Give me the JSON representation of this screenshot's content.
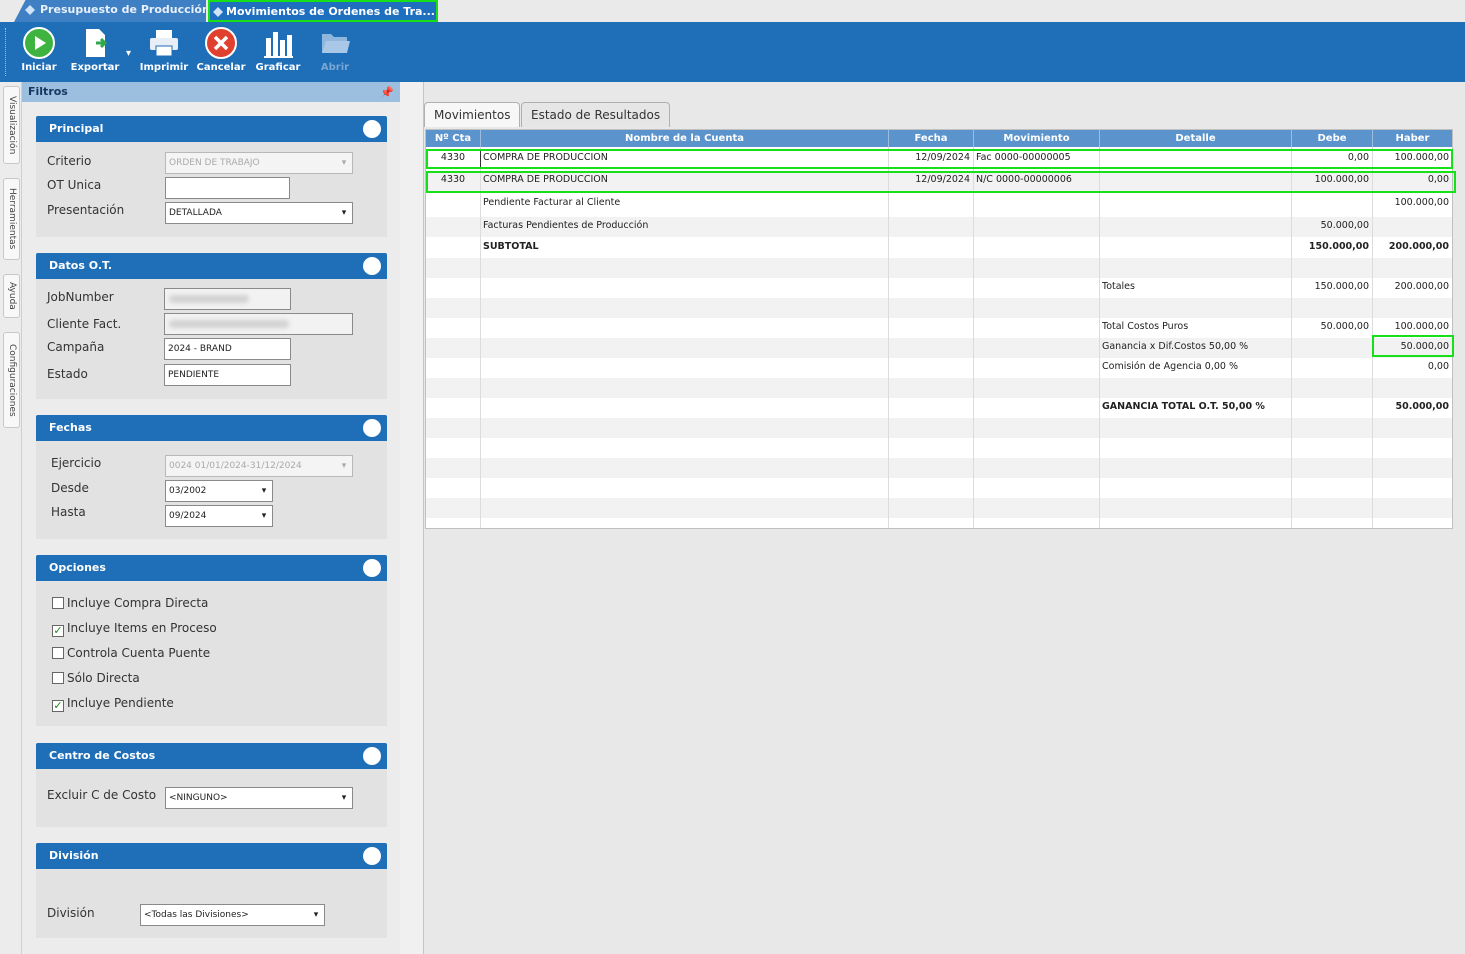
{
  "doc_tabs": [
    {
      "label": "Presupuesto de Producción"
    },
    {
      "label": "Movimientos de Ordenes de Tra..."
    }
  ],
  "toolbar": {
    "buttons": [
      {
        "label": "Iniciar",
        "icon": "play-icon"
      },
      {
        "label": "Exportar",
        "icon": "export-icon"
      },
      {
        "label": "Imprimir",
        "icon": "printer-icon"
      },
      {
        "label": "Cancelar",
        "icon": "cancel-icon"
      },
      {
        "label": "Graficar",
        "icon": "bar-chart-icon"
      },
      {
        "label": "Abrir",
        "icon": "folder-open-icon",
        "disabled": true
      }
    ]
  },
  "side_tabs": [
    "Visualización",
    "Herramientas",
    "Ayuda",
    "Configuraciones"
  ],
  "filters": {
    "title": "Filtros",
    "principal": {
      "title": "Principal",
      "criterio_label": "Criterio",
      "criterio_value": "ORDEN DE TRABAJO",
      "ot_unica_label": "OT Unica",
      "presentacion_label": "Presentación",
      "presentacion_value": "DETALLADA"
    },
    "datos_ot": {
      "title": "Datos O.T.",
      "jobnumber_label": "JobNumber",
      "cliente_label": "Cliente Fact.",
      "campana_label": "Campaña",
      "campana_value": "2024 - BRAND",
      "estado_label": "Estado",
      "estado_value": "PENDIENTE"
    },
    "fechas": {
      "title": "Fechas",
      "ejercicio_label": "Ejercicio",
      "ejercicio_value": "0024 01/01/2024-31/12/2024",
      "desde_label": "Desde",
      "desde_value": "03/2002",
      "hasta_label": "Hasta",
      "hasta_value": "09/2024"
    },
    "opciones": {
      "title": "Opciones",
      "items": [
        {
          "label": "Incluye Compra Directa",
          "checked": false
        },
        {
          "label": "Incluye Items en Proceso",
          "checked": true
        },
        {
          "label": "Controla Cuenta Puente",
          "checked": false
        },
        {
          "label": "Sólo Directa",
          "checked": false
        },
        {
          "label": "Incluye Pendiente",
          "checked": true
        }
      ]
    },
    "centro_costos": {
      "title": "Centro de Costos",
      "excluir_label": "Excluir C de Costo",
      "excluir_value": "<NINGUNO>"
    },
    "division": {
      "title": "División",
      "division_label": "División",
      "division_value": "<Todas las Divisiones>"
    }
  },
  "result_tabs": [
    "Movimientos",
    "Estado de Resultados"
  ],
  "grid": {
    "columns": [
      "Nº Cta",
      "Nombre de la Cuenta",
      "Fecha",
      "Movimiento",
      "Detalle",
      "Debe",
      "Haber"
    ],
    "rows": [
      {
        "cta": "4330",
        "nombre": "COMPRA DE PRODUCCION",
        "fecha": "12/09/2024",
        "mov": "Fac 0000-00000005",
        "detalle": "",
        "debe": "0,00",
        "haber": "100.000,00"
      },
      {
        "cta": "4330",
        "nombre": "COMPRA DE PRODUCCION",
        "fecha": "12/09/2024",
        "mov": "N/C 0000-00000006",
        "detalle": "",
        "debe": "100.000,00",
        "haber": "0,00"
      },
      {
        "cta": "",
        "nombre": "Pendiente Facturar al Cliente",
        "fecha": "",
        "mov": "",
        "detalle": "",
        "debe": "",
        "haber": "100.000,00"
      },
      {
        "cta": "",
        "nombre": "Facturas Pendientes de Producción",
        "fecha": "",
        "mov": "",
        "detalle": "",
        "debe": "50.000,00",
        "haber": ""
      },
      {
        "cta": "",
        "nombre": "SUBTOTAL",
        "fecha": "",
        "mov": "",
        "detalle": "",
        "debe": "150.000,00",
        "haber": "200.000,00",
        "bold": true
      },
      {
        "cta": "",
        "nombre": "",
        "fecha": "",
        "mov": "",
        "detalle": "",
        "debe": "",
        "haber": ""
      },
      {
        "cta": "",
        "nombre": "",
        "fecha": "",
        "mov": "",
        "detalle": "Totales",
        "debe": "150.000,00",
        "haber": "200.000,00"
      },
      {
        "cta": "",
        "nombre": "",
        "fecha": "",
        "mov": "",
        "detalle": "",
        "debe": "",
        "haber": ""
      },
      {
        "cta": "",
        "nombre": "",
        "fecha": "",
        "mov": "",
        "detalle": "Total Costos Puros",
        "debe": "50.000,00",
        "haber": "100.000,00"
      },
      {
        "cta": "",
        "nombre": "",
        "fecha": "",
        "mov": "",
        "detalle": "Ganancia x Dif.Costos 50,00 %",
        "debe": "",
        "haber": "50.000,00"
      },
      {
        "cta": "",
        "nombre": "",
        "fecha": "",
        "mov": "",
        "detalle": "Comisión de Agencia 0,00 %",
        "debe": "",
        "haber": "0,00"
      },
      {
        "cta": "",
        "nombre": "",
        "fecha": "",
        "mov": "",
        "detalle": "",
        "debe": "",
        "haber": ""
      },
      {
        "cta": "",
        "nombre": "",
        "fecha": "",
        "mov": "",
        "detalle": "GANANCIA TOTAL O.T. 50,00 %",
        "debe": "",
        "haber": "50.000,00",
        "bold": true
      },
      {
        "cta": "",
        "nombre": "",
        "fecha": "",
        "mov": "",
        "detalle": "",
        "debe": "",
        "haber": ""
      },
      {
        "cta": "",
        "nombre": "",
        "fecha": "",
        "mov": "",
        "detalle": "",
        "debe": "",
        "haber": ""
      },
      {
        "cta": "",
        "nombre": "",
        "fecha": "",
        "mov": "",
        "detalle": "",
        "debe": "",
        "haber": ""
      },
      {
        "cta": "",
        "nombre": "",
        "fecha": "",
        "mov": "",
        "detalle": "",
        "debe": "",
        "haber": ""
      },
      {
        "cta": "",
        "nombre": "",
        "fecha": "",
        "mov": "",
        "detalle": "",
        "debe": "",
        "haber": ""
      },
      {
        "cta": "",
        "nombre": "",
        "fecha": "",
        "mov": "",
        "detalle": "",
        "debe": "",
        "haber": ""
      }
    ]
  },
  "colors": {
    "toolbar": "#1f6fb8",
    "header": "#5b94cc",
    "highlight": "#18e018"
  }
}
